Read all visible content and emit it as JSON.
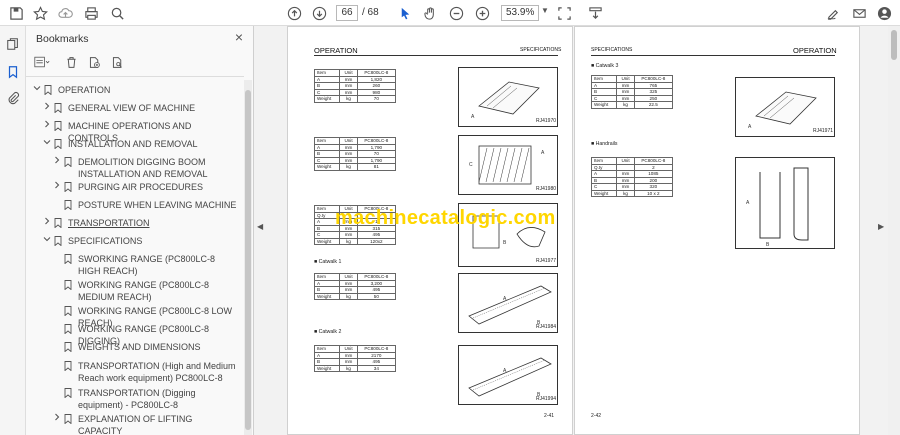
{
  "toolbar": {
    "icons": [
      "save-icon",
      "bookmark-star-icon",
      "upload-icon",
      "print-icon",
      "zoom-search-icon",
      "page-up-icon",
      "page-down-icon",
      "select-arrow-icon",
      "hand-icon",
      "zoom-out-icon",
      "zoom-in-icon",
      "fit-icon",
      "download-icon",
      "edit-sign-icon",
      "mail-icon",
      "account-icon"
    ],
    "page_current": "66",
    "page_total": "/ 68",
    "zoom": "53.9%"
  },
  "sidebar": {
    "title": "Bookmarks",
    "close": "×"
  },
  "bookmarks": [
    {
      "label": "OPERATION",
      "level": 0,
      "toggle": "v"
    },
    {
      "label": "GENERAL VIEW OF MACHINE",
      "level": 1,
      "toggle": ">"
    },
    {
      "label": "MACHINE OPERATIONS AND CONTROLS",
      "level": 1,
      "toggle": ">"
    },
    {
      "label": "INSTALLATION AND REMOVAL",
      "level": 1,
      "toggle": "v"
    },
    {
      "label": "DEMOLITION DIGGING BOOM INSTALLATION AND REMOVAL",
      "level": 2,
      "toggle": ">"
    },
    {
      "label": "PURGING AIR PROCEDURES",
      "level": 2,
      "toggle": ">"
    },
    {
      "label": "POSTURE WHEN LEAVING MACHINE",
      "level": 2,
      "toggle": ""
    },
    {
      "label": "TRANSPORTATION",
      "level": 1,
      "toggle": ">"
    },
    {
      "label": "SPECIFICATIONS",
      "level": 1,
      "toggle": "v"
    },
    {
      "label": "SWORKING RANGE (PC800LC-8 HIGH REACH)",
      "level": 2,
      "toggle": ""
    },
    {
      "label": "WORKING RANGE (PC800LC-8 MEDIUM REACH)",
      "level": 2,
      "toggle": ""
    },
    {
      "label": "WORKING RANGE (PC800LC-8 LOW REACH)",
      "level": 2,
      "toggle": ""
    },
    {
      "label": "WORKING RANGE (PC800LC-8 DIGGING)",
      "level": 2,
      "toggle": ""
    },
    {
      "label": "WEIGHTS AND DIMENSIONS",
      "level": 2,
      "toggle": ""
    },
    {
      "label": "TRANSPORTATION (High and Medium Reach work equipment) PC800LC-8",
      "level": 2,
      "toggle": ""
    },
    {
      "label": "TRANSPORTATION (Digging equipment) - PC800LC-8",
      "level": 2,
      "toggle": ""
    },
    {
      "label": "EXPLANATION OF LIFTING CAPACITY",
      "level": 2,
      "toggle": ">"
    }
  ],
  "page_left": {
    "header_left": "OPERATION",
    "header_right": "SPECIFICATIONS",
    "page_number": "2-41",
    "tables": [
      {
        "head": [
          "Item",
          "Unit",
          "PC800LC-8"
        ],
        "rows": [
          [
            "A",
            "mm",
            "1,820"
          ],
          [
            "B",
            "mm",
            "260"
          ],
          [
            "C",
            "mm",
            "980"
          ],
          [
            "Weight",
            "kg",
            "70"
          ]
        ],
        "caption": "RJ41970"
      },
      {
        "head": [
          "Item",
          "Unit",
          "PC800LC-8"
        ],
        "rows": [
          [
            "A",
            "mm",
            "1,790"
          ],
          [
            "B",
            "mm",
            "70"
          ],
          [
            "C",
            "mm",
            "1,790"
          ],
          [
            "Weight",
            "kg",
            "81"
          ]
        ],
        "caption": "RJ41980"
      },
      {
        "head": [
          "Item",
          "Unit",
          "PC800LC-8"
        ],
        "rows": [
          [
            "Q.ty",
            "",
            ""
          ],
          [
            "A",
            "mm",
            "1"
          ],
          [
            "B",
            "mm",
            "315"
          ],
          [
            "C",
            "mm",
            "495"
          ],
          [
            "Weight",
            "kg",
            "120x2"
          ]
        ],
        "caption": "RJ41977"
      },
      {
        "head": [
          "Item",
          "Unit",
          "PC800LC-8"
        ],
        "rows": [
          [
            "A",
            "mm",
            "3,200"
          ],
          [
            "B",
            "mm",
            "495"
          ],
          [
            "Weight",
            "kg",
            "50"
          ]
        ],
        "caption": "RJ41984"
      },
      {
        "head": [
          "Item",
          "Unit",
          "PC800LC-8"
        ],
        "rows": [
          [
            "A",
            "mm",
            "2170"
          ],
          [
            "B",
            "mm",
            "495"
          ],
          [
            "Weight",
            "kg",
            "34"
          ]
        ],
        "caption": "RJ41994"
      }
    ],
    "bullets": [
      "Catwalk 1",
      "Catwalk 2"
    ]
  },
  "page_right": {
    "header_left": "SPECIFICATIONS",
    "header_right": "OPERATION",
    "page_number": "2-42",
    "bullets": [
      "Catwalk 3",
      "Handrails"
    ],
    "tables": [
      {
        "head": [
          "Item",
          "Unit",
          "PC800LC-8"
        ],
        "rows": [
          [
            "A",
            "mm",
            "765"
          ],
          [
            "B",
            "mm",
            "325"
          ],
          [
            "C",
            "mm",
            "250"
          ],
          [
            "Weight",
            "kg",
            "22.5"
          ]
        ],
        "caption": "RJ41971"
      },
      {
        "head": [
          "Item",
          "Unit",
          "PC800LC-8"
        ],
        "rows": [
          [
            "Q.ty",
            "",
            "2"
          ],
          [
            "A",
            "mm",
            "1085"
          ],
          [
            "B",
            "mm",
            "200"
          ],
          [
            "C",
            "mm",
            "320"
          ],
          [
            "Weight",
            "kg",
            "10 x 2"
          ]
        ],
        "caption": ""
      }
    ]
  },
  "watermark": "machinecatalogic.com",
  "colors": {
    "watermark": "#ffd600",
    "panel_bg": "#f9f9f9",
    "doc_bg": "#f2f2f2"
  }
}
